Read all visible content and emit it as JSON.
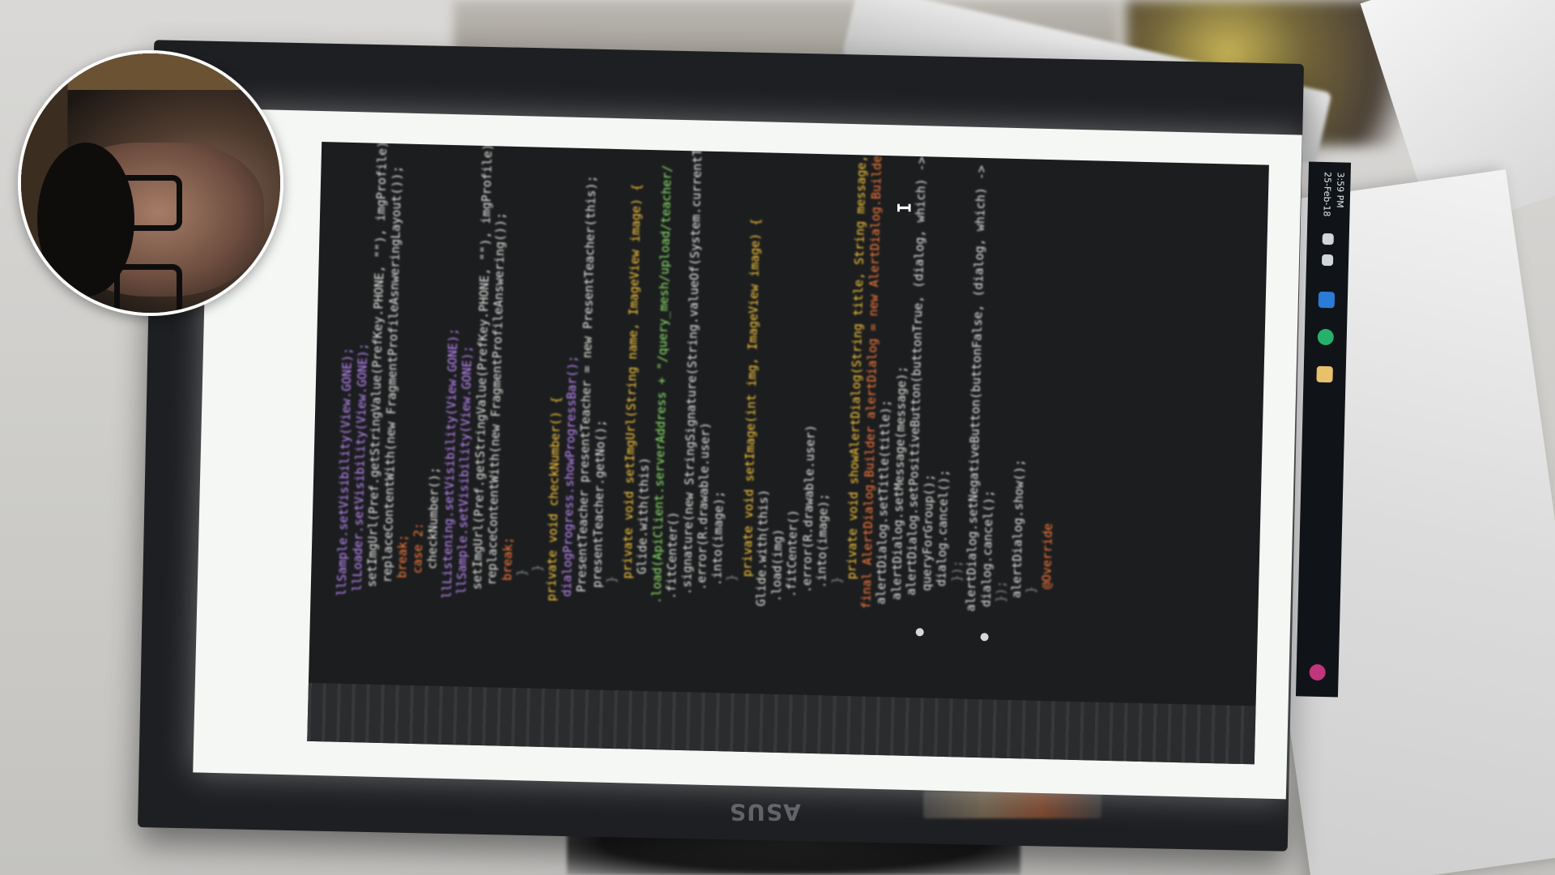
{
  "window": {
    "title": ""
  },
  "monitor": {
    "brand": "ASUS"
  },
  "taskbar": {
    "time": "3:59 PM",
    "date": "25-Feb-18"
  },
  "colors": {
    "background": "#cfcfcf",
    "editor_background": "#1c1d1f",
    "keyword": "#ff7d3a",
    "method": "#ffcb3a",
    "class_highlight": "#ff5d5d",
    "field": "#c38cff",
    "string": "#8ee86a"
  },
  "editor": {
    "code_lines": [
      "llSample.setVisibility(View.GONE);",
      "llLoader.setVisibility(View.GONE);",
      "setImgUrl(Pref.getStringValue(PrefKey.PHONE, \"\"), imgProfile);",
      "replaceContentWith(new FragmentProfileAsnweringLayout());",
      "break;",
      "case 2:",
      "checkNumber();",
      "llListening.setVisibility(View.GONE);",
      "llSample.setVisibility(View.GONE);",
      "setImgUrl(Pref.getStringValue(PrefKey.PHONE, \"\"), imgProfile);",
      "replaceContentWith(new FragmentProfileAnswering());",
      "break;",
      "}",
      "}",
      "private void checkNumber() {",
      "dialogProgress.showProgressBar();",
      "PresentTeacher presentTeacher = new PresentTeacher(this);",
      "presentTeacher.getNo();",
      "}",
      "private void setImgUrl(String name, ImageView image) {",
      "Glide.with(this)",
      ".load(ApiClient.serverAddress + \"/query_mesh/upload/teacher/",
      ".fitCenter()",
      ".signature(new StringSignature(String.valueOf(System.currentTime",
      ".error(R.drawable.user)",
      ".into(image);",
      "}",
      "private void setImage(int img, ImageView image) {",
      "Glide.with(this)",
      ".load(img)",
      ".fitCenter()",
      ".error(R.drawable.user)",
      ".into(image);",
      "}",
      "private void showAlertDialog(String title, String message, String buttonTrue",
      "final AlertDialog.Builder alertDialog = new AlertDialog.Builder(this);",
      "alertDialog.setTitle(title);",
      "alertDialog.setMessage(message);",
      "alertDialog.setPositiveButton(buttonTrue, (dialog, which) -> {",
      "queryForGroup();",
      "dialog.cancel();",
      "});",
      "alertDialog.setNegativeButton(buttonFalse, (dialog, which) -> {",
      "dialog.cancel();",
      "});",
      "alertDialog.show();",
      "}",
      "@Override"
    ]
  }
}
